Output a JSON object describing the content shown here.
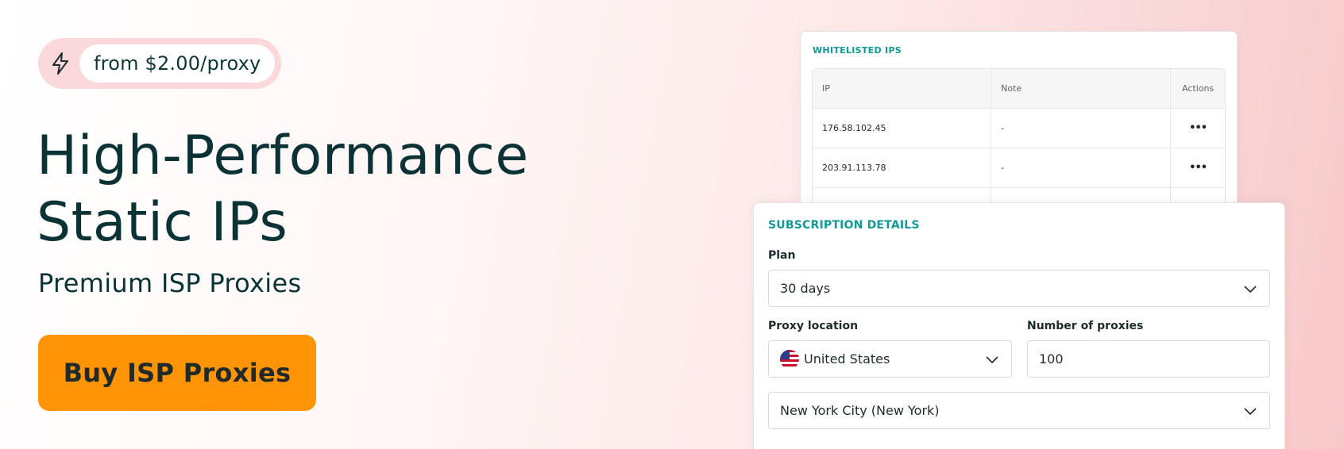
{
  "banner": {
    "price_label": "from $2.00/proxy",
    "title_line1": "High-Performance",
    "title_line2": "Static IPs",
    "subtitle": "Premium ISP Proxies",
    "cta_label": "Buy ISP Proxies",
    "icon": "bolt-icon"
  },
  "whitelist": {
    "title": "WHITELISTED IPS",
    "columns": [
      "IP",
      "Note",
      "Actions"
    ],
    "rows": [
      {
        "ip": "176.58.102.45",
        "note": "-",
        "actions": "•••"
      },
      {
        "ip": "203.91.113.78",
        "note": "-",
        "actions": "•••"
      }
    ]
  },
  "subscription": {
    "title": "SUBSCRIPTION DETAILS",
    "plan_label": "Plan",
    "plan_value": "30 days",
    "location_label": "Proxy location",
    "location_value": "United States",
    "count_label": "Number of proxies",
    "count_value": "100",
    "city_value": "New York City (New York)"
  },
  "colors": {
    "accent_teal": "#0f9a96",
    "cta_orange": "#ff9407",
    "pill_pink": "#fbd9da",
    "text_dark": "#0b3336"
  }
}
